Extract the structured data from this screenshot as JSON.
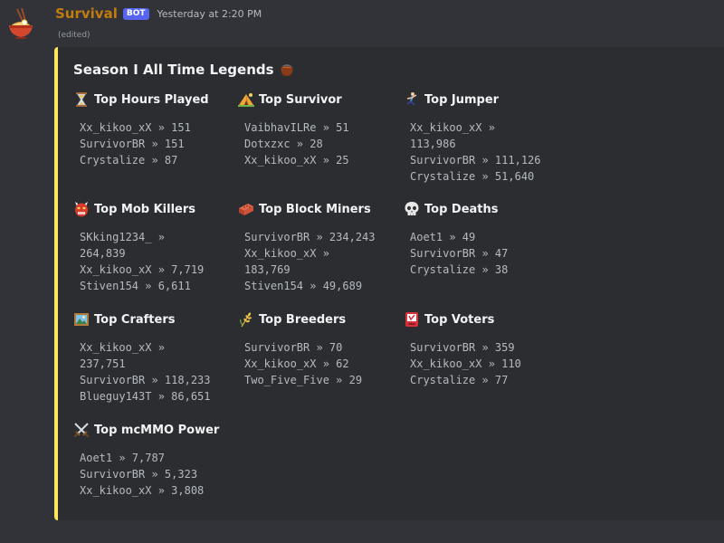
{
  "author": {
    "name": "Survival",
    "badge": "BOT",
    "timestamp": "Yesterday at 2:20 PM",
    "edited": "(edited)",
    "name_color": "#c27c0e",
    "avatar_icon": "ramen-bowl-avatar"
  },
  "embed": {
    "accent_color": "#fee75c",
    "title": "Season I All Time Legends",
    "title_icon": "witch-cauldron-icon",
    "fields": [
      {
        "name": "Top Hours Played",
        "icon": "hourglass-icon",
        "lines": [
          "Xx_kikoo_xX » 151",
          "SurvivorBR » 151",
          "Crystalize » 87"
        ]
      },
      {
        "name": "Top Survivor",
        "icon": "camping-tent-icon",
        "lines": [
          "VaibhavILRe » 51",
          "Dotxzxc » 28",
          "Xx_kikoo_xX » 25"
        ]
      },
      {
        "name": "Top Jumper",
        "icon": "person-jumping-icon",
        "lines": [
          "Xx_kikoo_xX »",
          "113,986",
          "SurvivorBR » 111,126",
          "Crystalize » 51,640"
        ]
      },
      {
        "name": "Top Mob Killers",
        "icon": "ogre-mask-icon",
        "lines": [
          "SKking1234_ »",
          "264,839",
          "Xx_kikoo_xX » 7,719",
          "Stiven154 » 6,611"
        ]
      },
      {
        "name": "Top Block Miners",
        "icon": "brick-icon",
        "lines": [
          "SurvivorBR » 234,243",
          "Xx_kikoo_xX »",
          "183,769",
          "Stiven154 » 49,689"
        ]
      },
      {
        "name": "Top Deaths",
        "icon": "skull-icon",
        "lines": [
          "Aoet1 » 49",
          "SurvivorBR » 47",
          "Crystalize » 38"
        ]
      },
      {
        "name": "Top Crafters",
        "icon": "framed-picture-icon",
        "lines": [
          "Xx_kikoo_xX »",
          "237,751",
          "SurvivorBR » 118,233",
          "Blueguy143T » 86,651"
        ]
      },
      {
        "name": "Top Breeders",
        "icon": "wheat-sheaf-icon",
        "lines": [
          "SurvivorBR » 70",
          "Xx_kikoo_xX » 62",
          "Two_Five_Five » 29"
        ]
      },
      {
        "name": "Top Voters",
        "icon": "ballot-box-icon",
        "lines": [
          "SurvivorBR » 359",
          "Xx_kikoo_xX » 110",
          "Crystalize » 77"
        ]
      },
      {
        "name": "Top mcMMO Power",
        "icon": "crossed-swords-icon",
        "lines": [
          "Aoet1 » 7,787",
          "SurvivorBR » 5,323",
          "Xx_kikoo_xX » 3,808"
        ]
      }
    ]
  }
}
